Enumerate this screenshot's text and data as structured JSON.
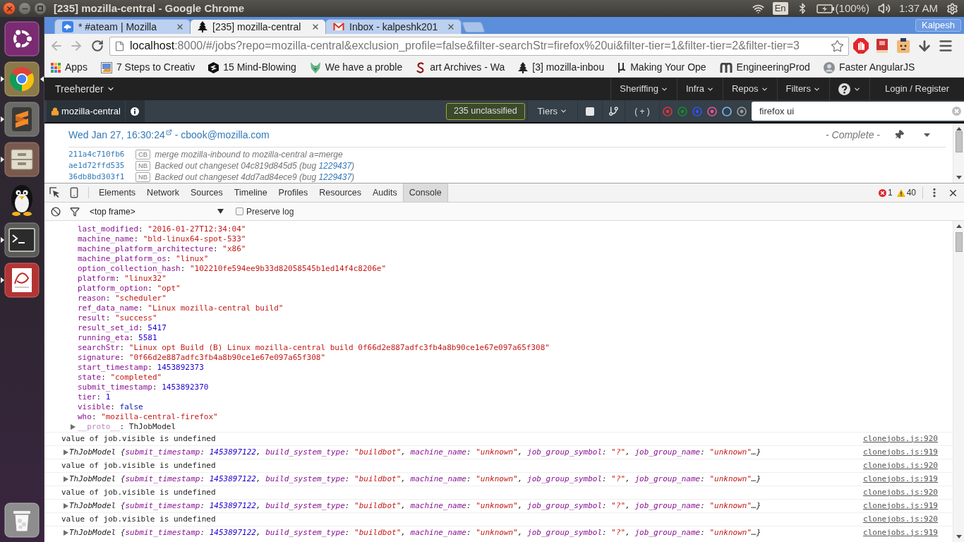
{
  "system_bar": {
    "window_title": "[235] mozilla-central - Google Chrome",
    "keyboard_layout": "En",
    "battery": "(100%)",
    "clock": "1:37 AM"
  },
  "launcher": {
    "items": [
      {
        "kind": "dash",
        "running": false,
        "focused": false
      },
      {
        "kind": "chrome",
        "running": true,
        "focused": true
      },
      {
        "kind": "editor",
        "running": true,
        "focused": false
      },
      {
        "kind": "files",
        "running": true,
        "focused": false
      },
      {
        "kind": "messenger",
        "running": false,
        "focused": false
      },
      {
        "kind": "terminal",
        "running": true,
        "focused": false
      },
      {
        "kind": "document",
        "running": true,
        "focused": false
      },
      {
        "kind": "trash",
        "running": false,
        "focused": false
      }
    ]
  },
  "browser": {
    "tabs": [
      {
        "title": "* #ateam | Mozilla",
        "kind": "chat",
        "selected": false
      },
      {
        "title": "[235] mozilla-central",
        "kind": "tree",
        "selected": true
      },
      {
        "title": "Inbox - kalpeshk201",
        "kind": "mail",
        "selected": false
      }
    ],
    "profile": "Kalpesh",
    "url": {
      "host": "localhost",
      "rest": ":8000/#/jobs?repo=mozilla-central&exclusion_profile=false&filter-searchStr=firefox%20ui&filter-tier=1&filter-tier=2&filter-tier=3"
    },
    "bookmarks": [
      {
        "label": "Apps",
        "kind": "apps"
      },
      {
        "label": "7 Steps to Creativ",
        "kind": "image"
      },
      {
        "label": "15 Mind-Blowing",
        "kind": "hexagon"
      },
      {
        "label": "We have a proble",
        "kind": "animal"
      },
      {
        "label": "art Archives - Wa",
        "kind": "letter-tile"
      },
      {
        "label": "[3] mozilla-inbou",
        "kind": "tree"
      },
      {
        "label": "Making Your Ope",
        "kind": "hook"
      },
      {
        "label": "EngineeringProd",
        "kind": "arches"
      },
      {
        "label": "Faster AngularJS",
        "kind": "avatar"
      }
    ]
  },
  "treeherder": {
    "brand": "Treeherder",
    "menus": [
      {
        "label": "Sheriffing"
      },
      {
        "label": "Infra"
      },
      {
        "label": "Repos"
      },
      {
        "label": "Filters"
      }
    ],
    "login": "Login / Register",
    "repo": "mozilla-central",
    "unclassified": "235 unclassified",
    "tiers": "Tiers",
    "add_filter": "( + )",
    "result_filters": [
      {
        "color": "#d9363e",
        "checked": true
      },
      {
        "color": "#178a33",
        "checked": true
      },
      {
        "color": "#2e55ec",
        "checked": true
      },
      {
        "color": "#e2549b",
        "checked": true
      },
      {
        "color": "#78b8f2",
        "checked": false
      },
      {
        "color": "#9b9b9b",
        "checked": true
      }
    ],
    "search": {
      "value": "firefox ui"
    }
  },
  "resultset": {
    "date": "Wed Jan 27, 16:30:24",
    "author": "- cbook@mozilla.com",
    "status": "- Complete -",
    "revisions": [
      {
        "hash": "211a4c710fb6",
        "badge": "CB",
        "message": "merge mozilla-inbound to mozilla-central a=merge"
      },
      {
        "hash": "ae1d72ffd535",
        "badge": "NB",
        "message": "Backed out changeset 04c819d845d5 (bug ",
        "bug": "1229437",
        "message_end": ")"
      },
      {
        "hash": "36db8bd303f1",
        "badge": "NB",
        "message": "Backed out changeset 4dd7ad84ece9 (bug ",
        "bug": "1229437",
        "message_end": ")"
      }
    ]
  },
  "devtools": {
    "tabs": [
      {
        "label": "Elements",
        "selected": false
      },
      {
        "label": "Network",
        "selected": false
      },
      {
        "label": "Sources",
        "selected": false
      },
      {
        "label": "Timeline",
        "selected": false
      },
      {
        "label": "Profiles",
        "selected": false
      },
      {
        "label": "Resources",
        "selected": false
      },
      {
        "label": "Audits",
        "selected": false
      },
      {
        "label": "Console",
        "selected": true
      }
    ],
    "error_count": "1",
    "warning_count": "40",
    "context": "<top frame>",
    "preserve_log": {
      "label": "Preserve log",
      "checked": false
    },
    "object_properties": [
      {
        "key": "last_modified",
        "punct": ":",
        "value": "\"2016-01-27T12:34:04\"",
        "kind": "string"
      },
      {
        "key": "machine_name",
        "punct": ":",
        "value": "\"bld-linux64-spot-533\"",
        "kind": "string"
      },
      {
        "key": "machine_platform_architecture",
        "punct": ":",
        "value": "\"x86\"",
        "kind": "string"
      },
      {
        "key": "machine_platform_os",
        "punct": ":",
        "value": "\"linux\"",
        "kind": "string"
      },
      {
        "key": "option_collection_hash",
        "punct": ":",
        "value": "\"102210fe594ee9b33d82058545b1ed14f4c8206e\"",
        "kind": "string"
      },
      {
        "key": "platform",
        "punct": ":",
        "value": "\"linux32\"",
        "kind": "string"
      },
      {
        "key": "platform_option",
        "punct": ":",
        "value": "\"opt\"",
        "kind": "string"
      },
      {
        "key": "reason",
        "punct": ":",
        "value": "\"scheduler\"",
        "kind": "string"
      },
      {
        "key": "ref_data_name",
        "punct": ":",
        "value": "\"Linux mozilla-central build\"",
        "kind": "string"
      },
      {
        "key": "result",
        "punct": ":",
        "value": "\"success\"",
        "kind": "string"
      },
      {
        "key": "result_set_id",
        "punct": ":",
        "value": "5417",
        "kind": "number"
      },
      {
        "key": "running_eta",
        "punct": ":",
        "value": "5581",
        "kind": "number"
      },
      {
        "key": "searchStr",
        "punct": ":",
        "value": "\"Linux opt Build (B) Linux mozilla-central build 0f66d2e887adfc3fb4a8b90ce1e67e097a65f308\"",
        "kind": "string"
      },
      {
        "key": "signature",
        "punct": ":",
        "value": "\"0f66d2e887adfc3fb4a8b90ce1e67e097a65f308\"",
        "kind": "string"
      },
      {
        "key": "start_timestamp",
        "punct": ":",
        "value": "1453892373",
        "kind": "number"
      },
      {
        "key": "state",
        "punct": ":",
        "value": "\"completed\"",
        "kind": "string"
      },
      {
        "key": "submit_timestamp",
        "punct": ":",
        "value": "1453892370",
        "kind": "number"
      },
      {
        "key": "tier",
        "punct": ":",
        "value": "1",
        "kind": "number"
      },
      {
        "key": "visible",
        "punct": ":",
        "value": "false",
        "kind": "boolean"
      },
      {
        "key": "who",
        "punct": ":",
        "value": "\"mozilla-central-firefox\"",
        "kind": "string"
      }
    ],
    "proto": {
      "key": "__proto__",
      "punct": ":",
      "value": "ThJobModel",
      "expanded": false
    },
    "messages": [
      {
        "kind": "text",
        "text": "value of job.visible is undefined",
        "source": "clonejobs.js:920"
      },
      {
        "kind": "object",
        "expanded": false,
        "class_name": "ThJobModel",
        "open": "{",
        "punct": ":",
        "sep": ",",
        "close": "…}",
        "props": [
          {
            "key": "submit_timestamp",
            "value": "1453897122",
            "kind": "number"
          },
          {
            "key": "build_system_type",
            "value": "\"buildbot\"",
            "kind": "string"
          },
          {
            "key": "machine_name",
            "value": "\"unknown\"",
            "kind": "string"
          },
          {
            "key": "job_group_symbol",
            "value": "\"?\"",
            "kind": "string"
          },
          {
            "key": "job_group_name",
            "value": "\"unknown\"",
            "kind": "string"
          }
        ],
        "source": "clonejobs.js:919"
      },
      {
        "kind": "text",
        "text": "value of job.visible is undefined",
        "source": "clonejobs.js:920"
      },
      {
        "kind": "object",
        "expanded": false,
        "class_name": "ThJobModel",
        "open": "{",
        "punct": ":",
        "sep": ",",
        "close": "…}",
        "props": [
          {
            "key": "submit_timestamp",
            "value": "1453897122",
            "kind": "number"
          },
          {
            "key": "build_system_type",
            "value": "\"buildbot\"",
            "kind": "string"
          },
          {
            "key": "machine_name",
            "value": "\"unknown\"",
            "kind": "string"
          },
          {
            "key": "job_group_symbol",
            "value": "\"?\"",
            "kind": "string"
          },
          {
            "key": "job_group_name",
            "value": "\"unknown\"",
            "kind": "string"
          }
        ],
        "source": "clonejobs.js:919"
      },
      {
        "kind": "text",
        "text": "value of job.visible is undefined",
        "source": "clonejobs.js:920"
      },
      {
        "kind": "object",
        "expanded": false,
        "class_name": "ThJobModel",
        "open": "{",
        "punct": ":",
        "sep": ",",
        "close": "…}",
        "props": [
          {
            "key": "submit_timestamp",
            "value": "1453897122",
            "kind": "number"
          },
          {
            "key": "build_system_type",
            "value": "\"buildbot\"",
            "kind": "string"
          },
          {
            "key": "machine_name",
            "value": "\"unknown\"",
            "kind": "string"
          },
          {
            "key": "job_group_symbol",
            "value": "\"?\"",
            "kind": "string"
          },
          {
            "key": "job_group_name",
            "value": "\"unknown\"",
            "kind": "string"
          }
        ],
        "source": "clonejobs.js:919"
      },
      {
        "kind": "text",
        "text": "value of job.visible is undefined",
        "source": "clonejobs.js:920"
      },
      {
        "kind": "object",
        "expanded": false,
        "class_name": "ThJobModel",
        "open": "{",
        "punct": ":",
        "sep": ",",
        "close": "…}",
        "props": [
          {
            "key": "submit_timestamp",
            "value": "1453897122",
            "kind": "number"
          },
          {
            "key": "build_system_type",
            "value": "\"buildbot\"",
            "kind": "string"
          },
          {
            "key": "machine_name",
            "value": "\"unknown\"",
            "kind": "string"
          },
          {
            "key": "job_group_symbol",
            "value": "\"?\"",
            "kind": "string"
          },
          {
            "key": "job_group_name",
            "value": "\"unknown\"",
            "kind": "string"
          }
        ],
        "source": "clonejobs.js:919"
      }
    ]
  }
}
